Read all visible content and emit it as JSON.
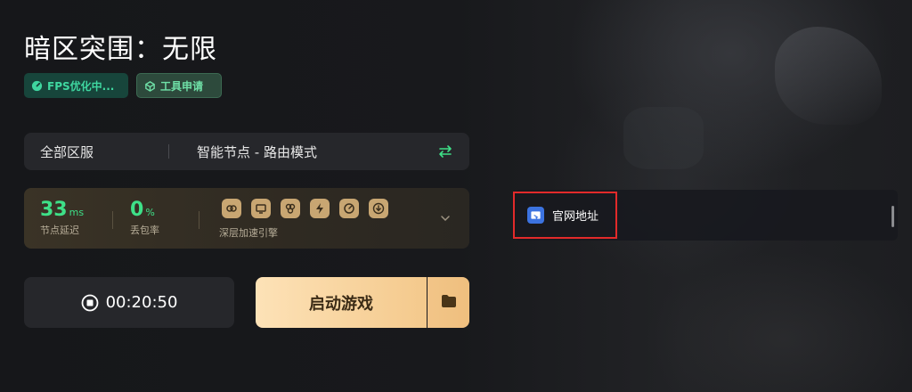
{
  "game": {
    "title": "暗区突围：无限"
  },
  "tags": {
    "fps": "FPS优化中...",
    "tool": "工具申请"
  },
  "region_bar": {
    "region": "全部区服",
    "node": "智能节点 - 路由模式"
  },
  "stats": {
    "latency_value": "33",
    "latency_unit": "ms",
    "latency_label": "节点延迟",
    "loss_value": "0",
    "loss_unit": "%",
    "loss_label": "丢包率",
    "engine_label": "深层加速引擎"
  },
  "timer": {
    "elapsed": "00:20:50"
  },
  "launch": {
    "label": "启动游戏"
  },
  "links": [
    {
      "label": "官网地址",
      "icon": "website-icon"
    }
  ],
  "colors": {
    "accent_green": "#3ee088",
    "launch_gold": "#f4c98c",
    "highlight_red": "#e22a2a"
  }
}
